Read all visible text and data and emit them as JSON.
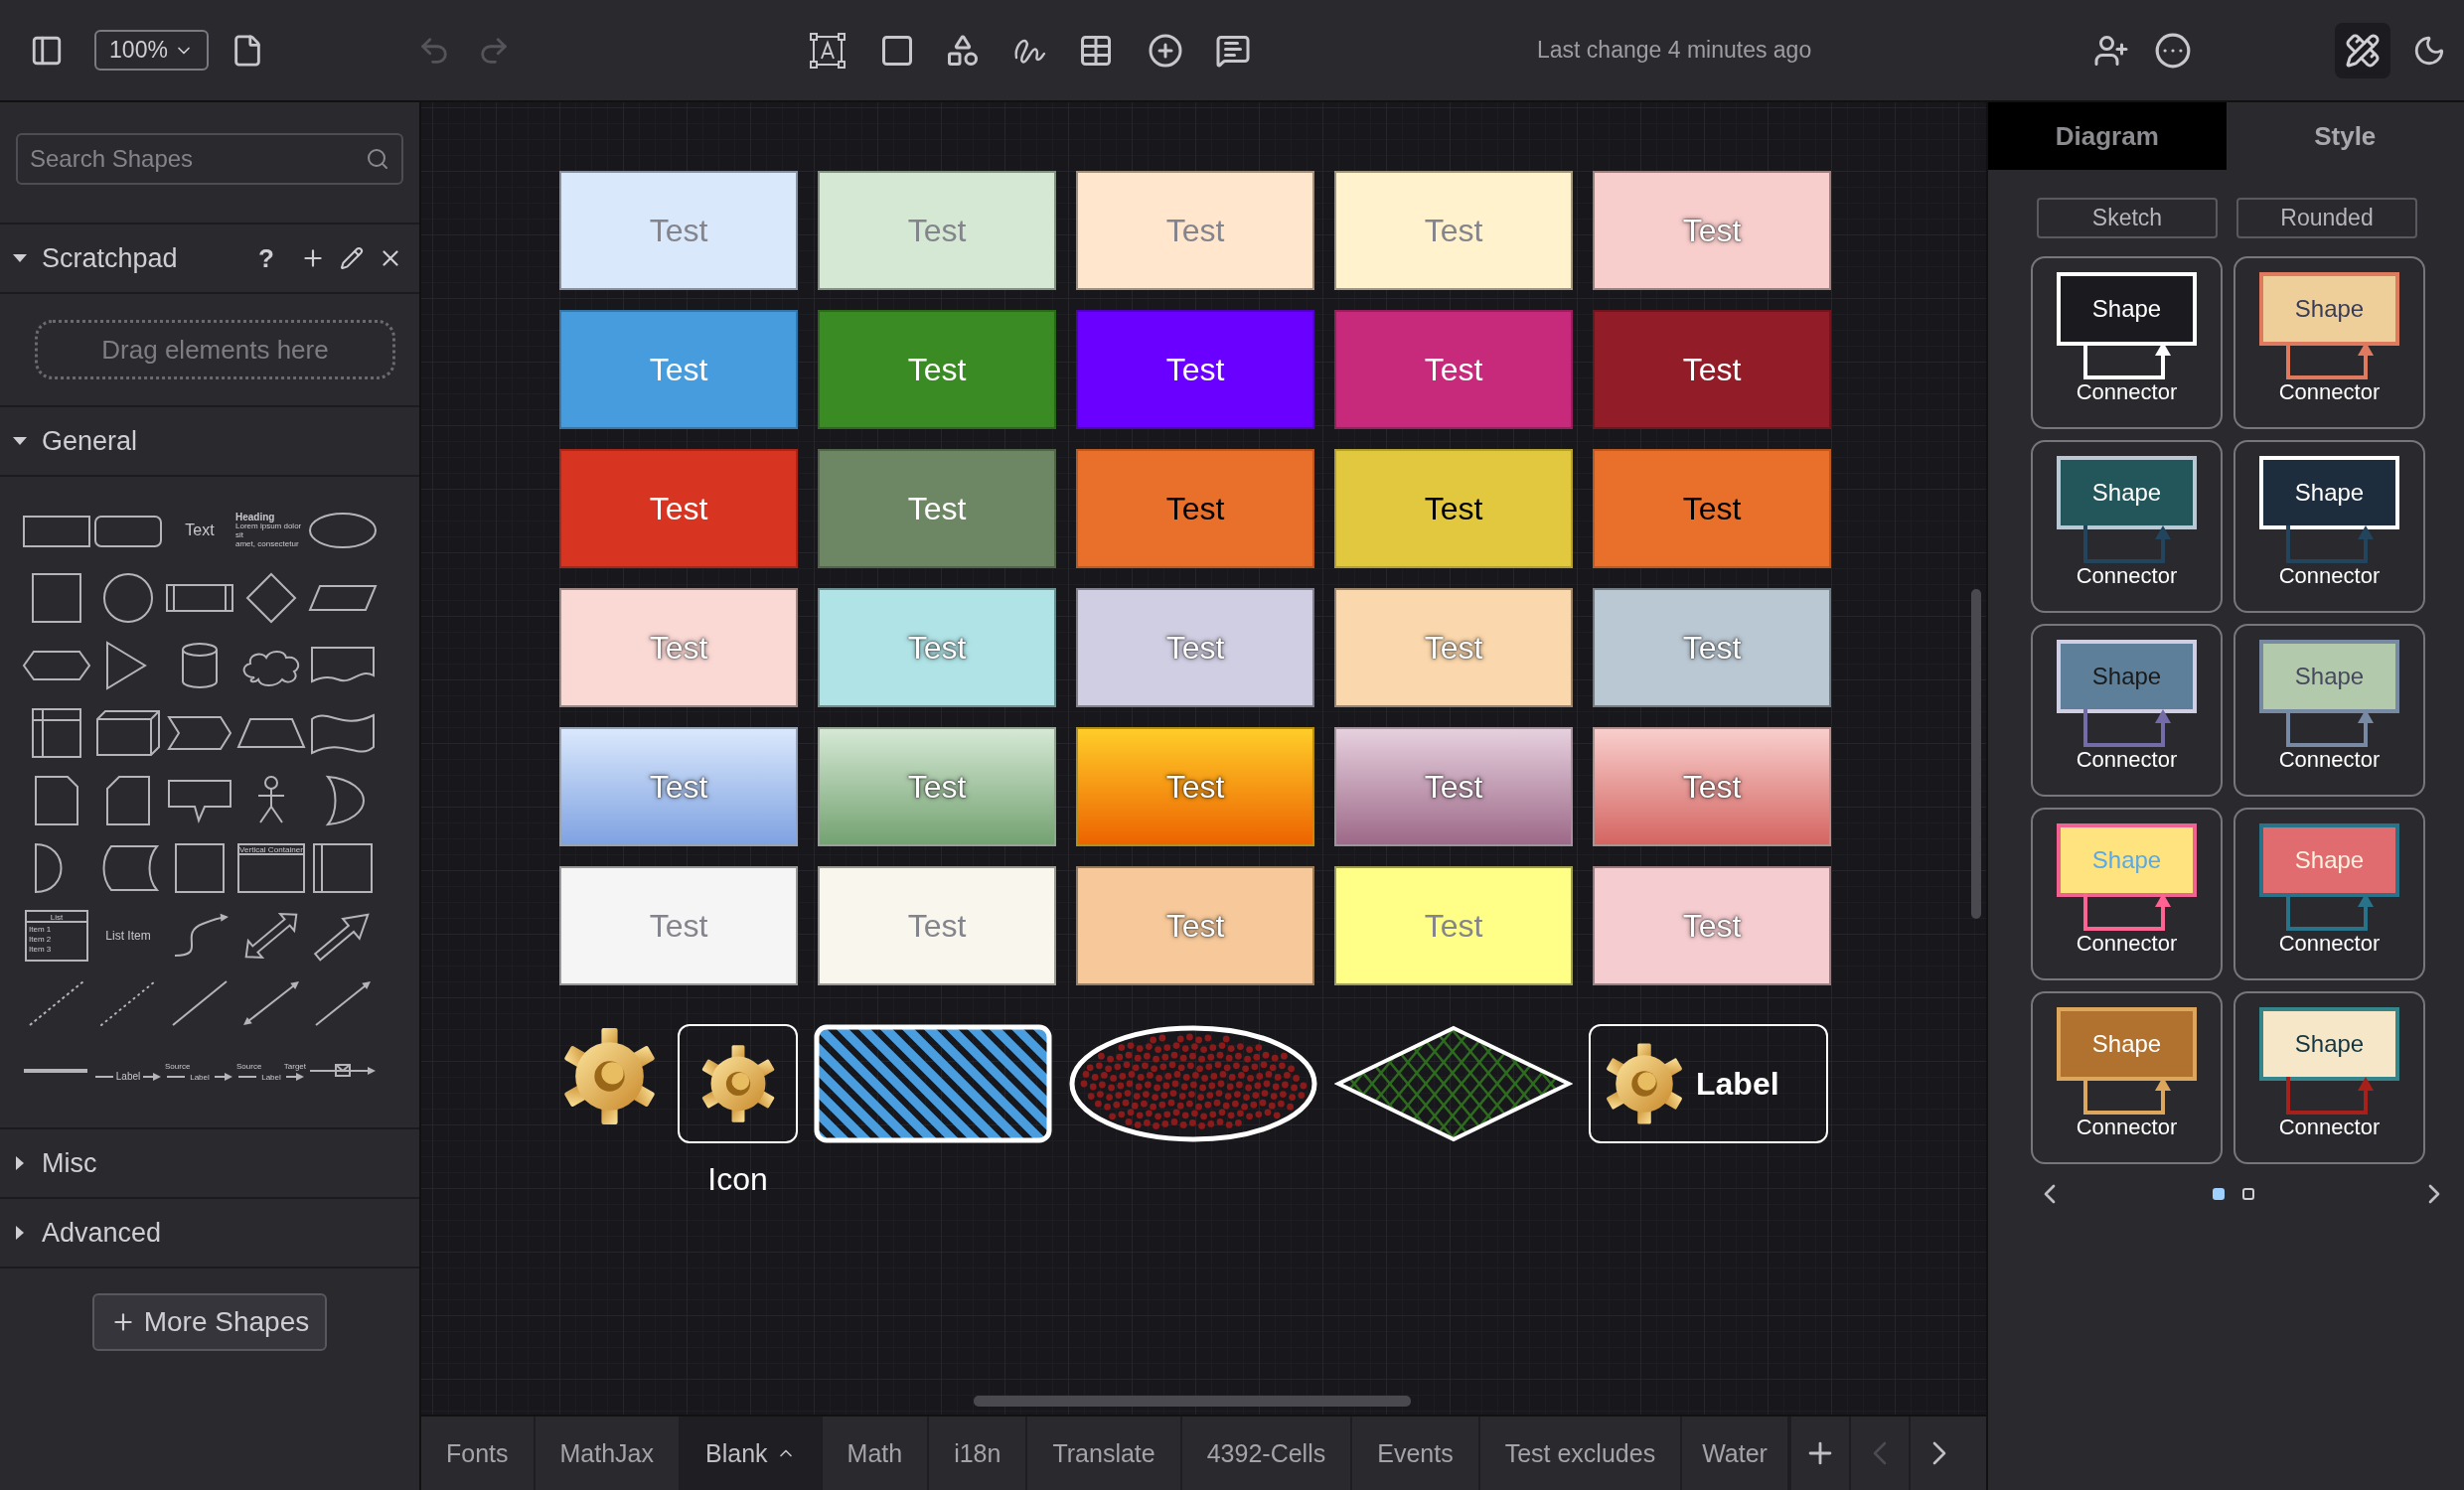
{
  "toolbar": {
    "zoom": "100%",
    "undo": {
      "disabled": true
    },
    "redo": {
      "disabled": true
    },
    "status": "Last change 4 minutes ago",
    "format_panel": {
      "on": true
    }
  },
  "sidebar": {
    "search": {
      "placeholder": "Search Shapes"
    },
    "sections": [
      {
        "kind": "scratchpad",
        "title": "Scratchpad",
        "expanded": true,
        "help": "?",
        "hint": "Drag elements here"
      },
      {
        "kind": "palette",
        "title": "General",
        "expanded": true,
        "shapes": [
          {
            "kind": "rectangle"
          },
          {
            "kind": "rounded-rectangle"
          },
          {
            "kind": "text",
            "label": "Text"
          },
          {
            "kind": "heading",
            "label": "Heading",
            "lines": [
              "Lorem ipsum dolor sit",
              "amet, consectetur"
            ]
          },
          {
            "kind": "ellipse"
          },
          {
            "kind": "square"
          },
          {
            "kind": "circle"
          },
          {
            "kind": "process"
          },
          {
            "kind": "diamond"
          },
          {
            "kind": "parallelogram"
          },
          {
            "kind": "hexagon"
          },
          {
            "kind": "triangle"
          },
          {
            "kind": "cylinder"
          },
          {
            "kind": "cloud"
          },
          {
            "kind": "document"
          },
          {
            "kind": "internal-storage"
          },
          {
            "kind": "cube"
          },
          {
            "kind": "step"
          },
          {
            "kind": "trapezoid"
          },
          {
            "kind": "tape"
          },
          {
            "kind": "note"
          },
          {
            "kind": "card"
          },
          {
            "kind": "callout"
          },
          {
            "kind": "actor"
          },
          {
            "kind": "or"
          },
          {
            "kind": "and"
          },
          {
            "kind": "data-storage"
          },
          {
            "kind": "container"
          },
          {
            "kind": "vertical-container",
            "label": "Vertical Container"
          },
          {
            "kind": "horizontal-container"
          },
          {
            "kind": "list",
            "label": "List",
            "items": [
              "Item 1",
              "Item 2",
              "Item 3"
            ]
          },
          {
            "kind": "list-item",
            "label": "List Item"
          },
          {
            "kind": "curve"
          },
          {
            "kind": "double-arrow"
          },
          {
            "kind": "block-arrow"
          },
          {
            "kind": "dashed-line"
          },
          {
            "kind": "dotted-line"
          },
          {
            "kind": "line"
          },
          {
            "kind": "bidirectional-line"
          },
          {
            "kind": "arrow-line"
          },
          {
            "kind": "thick-line"
          },
          {
            "kind": "labeled-connector",
            "labels": [
              "Label"
            ]
          },
          {
            "kind": "source-connector",
            "labels": [
              "Source",
              "Label"
            ]
          },
          {
            "kind": "source-target-connector",
            "labels": [
              "Source",
              "Label",
              "Target"
            ]
          },
          {
            "kind": "message-connector"
          }
        ]
      },
      {
        "kind": "palette",
        "title": "Misc",
        "expanded": false
      },
      {
        "kind": "palette",
        "title": "Advanced",
        "expanded": false
      }
    ],
    "more_button": "More Shapes"
  },
  "canvas": {
    "rows": [
      {
        "tiles": [
          {
            "label": "Test",
            "color": "#dae8fc",
            "kind": "pale"
          },
          {
            "label": "Test",
            "color": "#d5e8d4",
            "kind": "pale"
          },
          {
            "label": "Test",
            "color": "#ffe6cc",
            "kind": "pale"
          },
          {
            "label": "Test",
            "color": "#fff2cc",
            "kind": "pale"
          },
          {
            "label": "Test",
            "color": "#f8cecc",
            "kind": "light"
          }
        ]
      },
      {
        "tiles": [
          {
            "label": "Test",
            "color": "#479cde",
            "kind": "solid"
          },
          {
            "label": "Test",
            "color": "#3a8b24",
            "kind": "solid"
          },
          {
            "label": "Test",
            "color": "#6a00ff",
            "kind": "solid"
          },
          {
            "label": "Test",
            "color": "#c72a7a",
            "kind": "solid"
          },
          {
            "label": "Test",
            "color": "#921c28",
            "kind": "solid"
          }
        ]
      },
      {
        "tiles": [
          {
            "label": "Test",
            "color": "#d73522",
            "kind": "solid"
          },
          {
            "label": "Test",
            "color": "#6d8764",
            "kind": "solid"
          },
          {
            "label": "Test",
            "color": "#e8702b",
            "kind": "dark-text"
          },
          {
            "label": "Test",
            "color": "#e1c83f",
            "kind": "dark-text"
          },
          {
            "label": "Test",
            "color": "#e8702b",
            "kind": "dark-text"
          }
        ]
      },
      {
        "tiles": [
          {
            "label": "Test",
            "color": "#fad9d5",
            "kind": "light"
          },
          {
            "label": "Test",
            "color": "#b0e3e6",
            "kind": "light"
          },
          {
            "label": "Test",
            "color": "#d0cee2",
            "kind": "light"
          },
          {
            "label": "Test",
            "color": "#fad7ac",
            "kind": "light"
          },
          {
            "label": "Test",
            "color": "#bac8d3",
            "kind": "light"
          }
        ]
      },
      {
        "tiles": [
          {
            "label": "Test",
            "color": "#dae8fc",
            "kind": "gradient"
          },
          {
            "label": "Test",
            "color": "#d5e8d4",
            "kind": "gradient"
          },
          {
            "label": "Test",
            "color": "#ffcd28",
            "kind": "gradient"
          },
          {
            "label": "Test",
            "color": "#e6d0de",
            "kind": "gradient"
          },
          {
            "label": "Test",
            "color": "#f8cecc",
            "kind": "gradient"
          }
        ]
      },
      {
        "tiles": [
          {
            "label": "Test",
            "color": "#f5f5f5",
            "kind": "pale"
          },
          {
            "label": "Test",
            "color": "#f9f7ed",
            "kind": "pale"
          },
          {
            "label": "Test",
            "color": "#f7c99a",
            "kind": "light"
          },
          {
            "label": "Test",
            "color": "#ffff88",
            "kind": "pale"
          },
          {
            "label": "Test",
            "color": "#f5ccd0",
            "kind": "light"
          }
        ]
      }
    ],
    "shapes": [
      {
        "kind": "image"
      },
      {
        "kind": "icon",
        "label": "Icon"
      },
      {
        "kind": "hatched-rectangle",
        "color": "#4a9ddf"
      },
      {
        "kind": "dotted-ellipse",
        "color": "#8b1a1a"
      },
      {
        "kind": "crosshatched-diamond",
        "color": "#2e6b1f"
      },
      {
        "kind": "label-box",
        "label": "Label"
      }
    ]
  },
  "page_tabs": [
    {
      "label": "Fonts",
      "selected": false
    },
    {
      "label": "MathJax",
      "selected": false
    },
    {
      "label": "Blank",
      "selected": true
    },
    {
      "label": "Math",
      "selected": false
    },
    {
      "label": "i18n",
      "selected": false
    },
    {
      "label": "Translate",
      "selected": false
    },
    {
      "label": "4392-Cells",
      "selected": false
    },
    {
      "label": "Events",
      "selected": false
    },
    {
      "label": "Test excludes",
      "selected": false
    },
    {
      "label": "Water",
      "selected": false
    }
  ],
  "page_nav": {
    "previous_disabled": true,
    "next_disabled": false
  },
  "format_panel": {
    "tabs": [
      {
        "label": "Diagram",
        "selected": false
      },
      {
        "label": "Style",
        "selected": true
      }
    ],
    "buttons": [
      "Sketch",
      "Rounded"
    ],
    "styles": [
      {
        "shape": "Shape",
        "connector": "Connector",
        "color": "#1a1a1f",
        "kind": "mono"
      },
      {
        "shape": "Shape",
        "connector": "Connector",
        "color": "#eecf9a",
        "kind": "sand"
      },
      {
        "shape": "Shape",
        "connector": "Connector",
        "color": "#23565a",
        "kind": "teal"
      },
      {
        "shape": "Shape",
        "connector": "Connector",
        "color": "#1e2d3d",
        "kind": "navy"
      },
      {
        "shape": "Shape",
        "connector": "Connector",
        "color": "#5d7f99",
        "kind": "slate"
      },
      {
        "shape": "Shape",
        "connector": "Connector",
        "color": "#b2c9ab",
        "kind": "sage"
      },
      {
        "shape": "Shape",
        "connector": "Connector",
        "color": "#fee37f",
        "kind": "sunny"
      },
      {
        "shape": "Shape",
        "connector": "Connector",
        "color": "#e06c6f",
        "kind": "coral"
      },
      {
        "shape": "Shape",
        "connector": "Connector",
        "color": "#b1722f",
        "kind": "amber"
      },
      {
        "shape": "Shape",
        "connector": "Connector",
        "color": "#f6e7c8",
        "kind": "cream"
      }
    ],
    "pages": [
      {
        "selected": true
      },
      {
        "selected": false
      }
    ]
  }
}
